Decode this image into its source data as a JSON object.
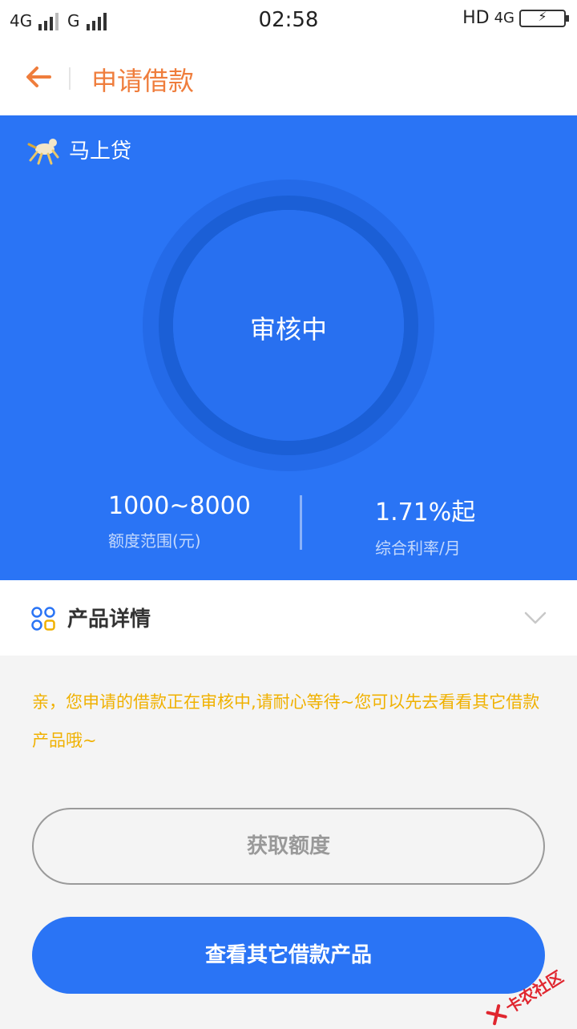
{
  "status_bar": {
    "left_network_1": "4G",
    "left_network_2": "G",
    "time": "02:58",
    "right_network": "HD",
    "right_network_sub": "4G"
  },
  "header": {
    "title": "申请借款",
    "accent_color": "#ef7d3c"
  },
  "hero": {
    "brand_name": "马上贷",
    "status": "审核中",
    "amount_value": "1000~8000",
    "amount_label": "额度范围(元)",
    "rate_value": "1.71%起",
    "rate_label": "综合利率/月",
    "background_color": "#2a74f5"
  },
  "details": {
    "title": "产品详情"
  },
  "notice": {
    "text": "亲，您申请的借款正在审核中,请耐心等待~您可以先去看看其它借款产品哦~",
    "color": "#f0b100"
  },
  "buttons": {
    "get_quota": "获取额度",
    "view_other_products": "查看其它借款产品"
  },
  "watermark": {
    "text": "卡农社区"
  }
}
